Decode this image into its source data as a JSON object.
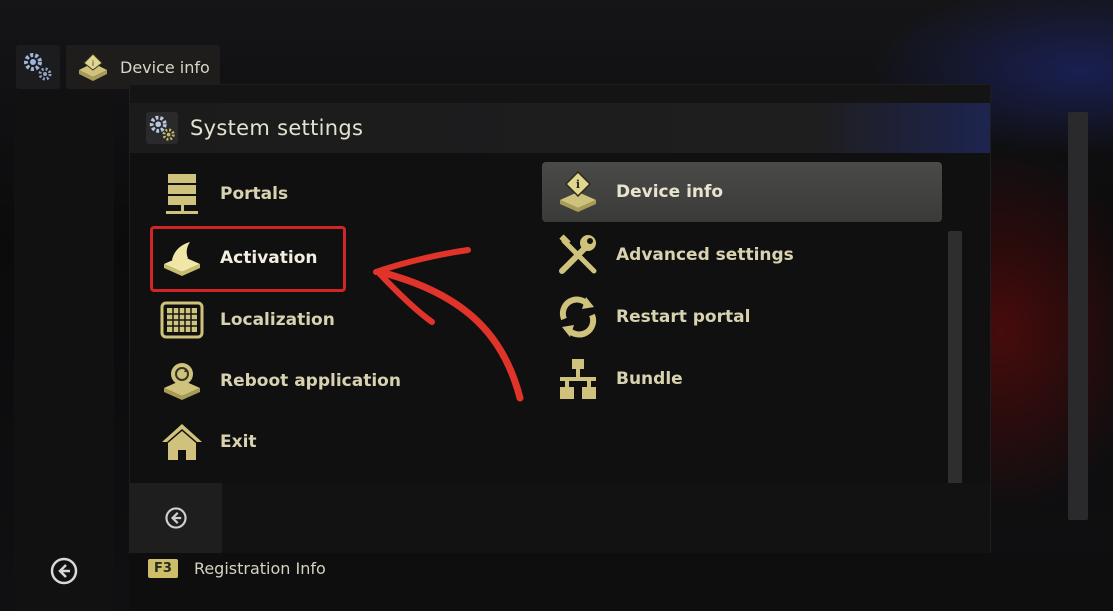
{
  "breadcrumb": {
    "current": "Device info"
  },
  "dialog": {
    "title": "System settings"
  },
  "left_menu": [
    {
      "label": "Portals",
      "icon": "server-icon"
    },
    {
      "label": "Activation",
      "icon": "activation-icon",
      "highlighted": true
    },
    {
      "label": "Localization",
      "icon": "keyboard-icon"
    },
    {
      "label": "Reboot application",
      "icon": "reboot-icon"
    },
    {
      "label": "Exit",
      "icon": "home-icon"
    }
  ],
  "right_menu": [
    {
      "label": "Device info",
      "icon": "device-info-icon",
      "selected": true
    },
    {
      "label": "Advanced settings",
      "icon": "tools-icon"
    },
    {
      "label": "Restart portal",
      "icon": "refresh-icon"
    },
    {
      "label": "Bundle",
      "icon": "network-icon"
    }
  ],
  "footer": {
    "key": "F3",
    "label": "Registration Info"
  },
  "colors": {
    "highlight": "#d12424",
    "icon_gold": "#d9cf86",
    "arrow": "#e0342b"
  }
}
